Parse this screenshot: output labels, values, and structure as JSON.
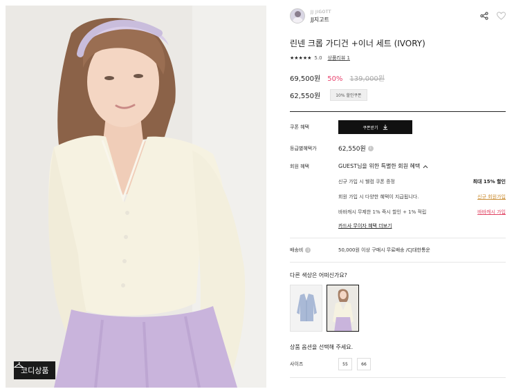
{
  "hero": {
    "badge_label": "코디상품"
  },
  "brand": {
    "name_en": "JJ JIGOTT",
    "name_ko": "JJ지고트"
  },
  "product": {
    "title": "린넨 크롭 가디건 +이너 세트 (IVORY)",
    "stars": "★★★★★",
    "rating": "5.0",
    "review_label": "상품리뷰 1",
    "price": "69,500원",
    "discount": "50%",
    "original_price": "139,000원",
    "coupon_price": "62,550원",
    "coupon_badge": "10% 할인쿠폰"
  },
  "benefits": {
    "coupon_label": "쿠폰 혜택",
    "coupon_button": "쿠폰받기",
    "grade_label": "등급별혜택가",
    "grade_price": "62,550원",
    "member_label": "회원 혜택",
    "member_title": "GUEST님을 위한 특별한 회원 혜택",
    "items": [
      {
        "text": "신규 가입 시 웰컴 쿠폰 증정",
        "right": "최대 15% 할인"
      },
      {
        "text": "회원 가입 시 다양한 혜택이 지급됩니다.",
        "right": "신규 회원가입"
      },
      {
        "text": "바바캐시 무제한 1% 즉시 할인 + 1% 적립",
        "right": "바바캐시 가입"
      }
    ],
    "card_link": "카드사 무이자 혜택 더보기"
  },
  "shipping": {
    "label": "배송비",
    "text": "50,000원 이상 구매시 무료배송 /CJ대한통운"
  },
  "colors": {
    "question": "다른 색상은 어떠신가요?",
    "swatches": [
      "light-blue-cardigan",
      "ivory-cardigan"
    ]
  },
  "options": {
    "question": "상품 옵션을 선택해 주세요.",
    "size_label": "사이즈",
    "sizes": [
      "55",
      "66"
    ]
  },
  "palette": {
    "accent_red": "#e8416d",
    "link_orange": "#c98a2d",
    "dark": "#111111"
  }
}
